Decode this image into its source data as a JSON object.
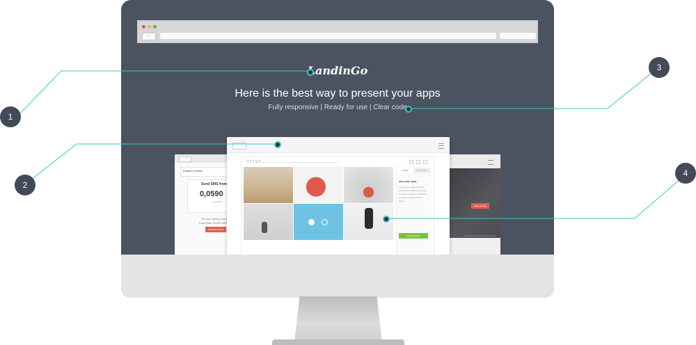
{
  "page": {
    "logo": "LandinGo",
    "headline": "Here is the best way to present your apps",
    "subline": "Fully responsive | Ready for use | Clear code"
  },
  "browser": {
    "nav_arrows": "‹ ›"
  },
  "mock_left": {
    "header": "Estados Unidos",
    "send_label": "Send SMS from",
    "price": "0,0590",
    "price_unit": "per SMS",
    "question": "Do you need to send more than 10,000 SMS?",
    "cta": "Request a quote"
  },
  "mock_main": {
    "brand": "OTTSP",
    "tab_left": "LOGIN",
    "tab_right": "REGISTER",
    "panel_title": "WELCOME HOME",
    "panel_text": "Lorem ipsum dolor sit amet consectetur adipiscing elit sed do eiusmod tempor incididunt ut labore et dolore magna aliqua",
    "panel_button": "Download App"
  },
  "mock_right": {
    "cta": "Sign up Free"
  },
  "callouts": {
    "c1": "1",
    "c2": "2",
    "c3": "3",
    "c4": "4"
  },
  "colors": {
    "accent": "#3cc6c0",
    "dark": "#424957",
    "screen_bg": "#4b5361",
    "cta_red": "#e0614f",
    "cta_green": "#7ac143",
    "tile_blue": "#6ec3e4"
  }
}
